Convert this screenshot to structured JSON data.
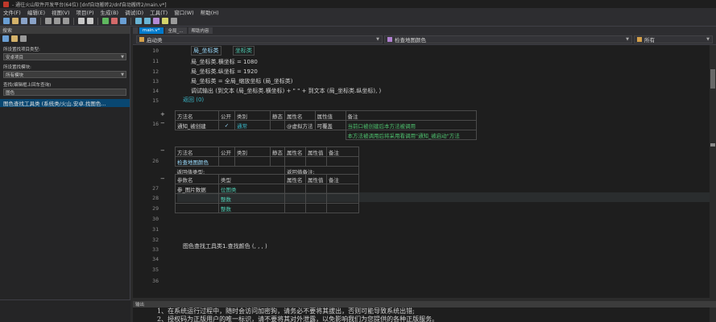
{
  "window": {
    "title": "- 通往火山软件开发平台(64位) [dnf自动搬砖2/dnf自动搬砖2/main.v*]"
  },
  "menu": [
    "文件(F)",
    "编辑(E)",
    "视图(V)",
    "项目(P)",
    "生成(B)",
    "调试(D)",
    "工具(T)",
    "窗口(W)",
    "帮助(H)"
  ],
  "left_panel": {
    "header": "搜索",
    "label_project_type": "所设置找项目类型:",
    "project_type": "安卓项目",
    "label_module": "所设置找模块:",
    "module": "所有模块",
    "label_search": "查找(编辑框上回车查询)",
    "search_value": "图色",
    "result": "图色查找工具类 (系统类/火山.安卓.找图色..."
  },
  "tabs": [
    {
      "label": "main.v*",
      "active": true
    },
    {
      "label": "全局_...",
      "active": false
    },
    {
      "label": "帮助内容",
      "active": false
    }
  ],
  "nav": {
    "class_combo": "启动类",
    "method_combo": "检查地图颜色",
    "all_combo": "所有"
  },
  "code": {
    "l10": "局_坐标类",
    "l10b": "坐标类",
    "l11": "局_坐标类.横坐标 = 1080",
    "l12": "局_坐标类.纵坐标 = 1920",
    "l13": "局_坐标类 = 全局_缩放坐标 (局_坐标类)",
    "l14": "调试输出 (到文本 (局_坐标类.横坐标) + \" \" + 到文本 (局_坐标类.纵坐标), )",
    "l15": "返回 (0)",
    "l33": "图色查找工具类1.查找颜色 (, , , )"
  },
  "line_numbers": [
    "10",
    "11",
    "12",
    "13",
    "14",
    "15",
    "16",
    "26",
    "27",
    "28",
    "29",
    "30",
    "31",
    "32",
    "33",
    "34",
    "35",
    "36"
  ],
  "method_table_1": {
    "headers": [
      "方法名",
      "公开",
      "类别",
      "静态",
      "属性名",
      "属性值",
      "备注"
    ],
    "row": [
      "通知_被创建",
      "✓",
      "通常",
      "",
      "@虚拟方法",
      "可覆盖",
      "当前口被创建后本方法被调用"
    ],
    "note2": "本方法被调用后将采用看调用\"通知_被启动\"方法"
  },
  "method_table_2": {
    "headers": [
      "方法名",
      "公开",
      "类别",
      "静态",
      "属性名",
      "属性值",
      "备注"
    ],
    "method": "检查地图颜色",
    "return_type_label": "返回值类型:",
    "return_attr_label": "返回值备注:",
    "param_headers": [
      "参数名",
      "类型",
      "",
      "属性名",
      "属性值",
      "备注"
    ],
    "params": [
      {
        "name": "参_图片数据",
        "type": "位图类"
      },
      {
        "name": "",
        "type": "整数"
      },
      {
        "name": "",
        "type": "整数"
      }
    ]
  },
  "output": {
    "header": "输出",
    "line1": "1、在系统运行过程中，随时会访问加密狗，请务必不要将其拔出，否则可能导致系统出错;",
    "line2": "2、授权码为正版用户的唯一标识，请不要将其对外泄露，以免影响我们为您提供的各种正版服务。"
  },
  "colors": {
    "accent": "#007acc",
    "editor_bg": "#1e1e1e",
    "type_color": "#4ec9b0"
  }
}
